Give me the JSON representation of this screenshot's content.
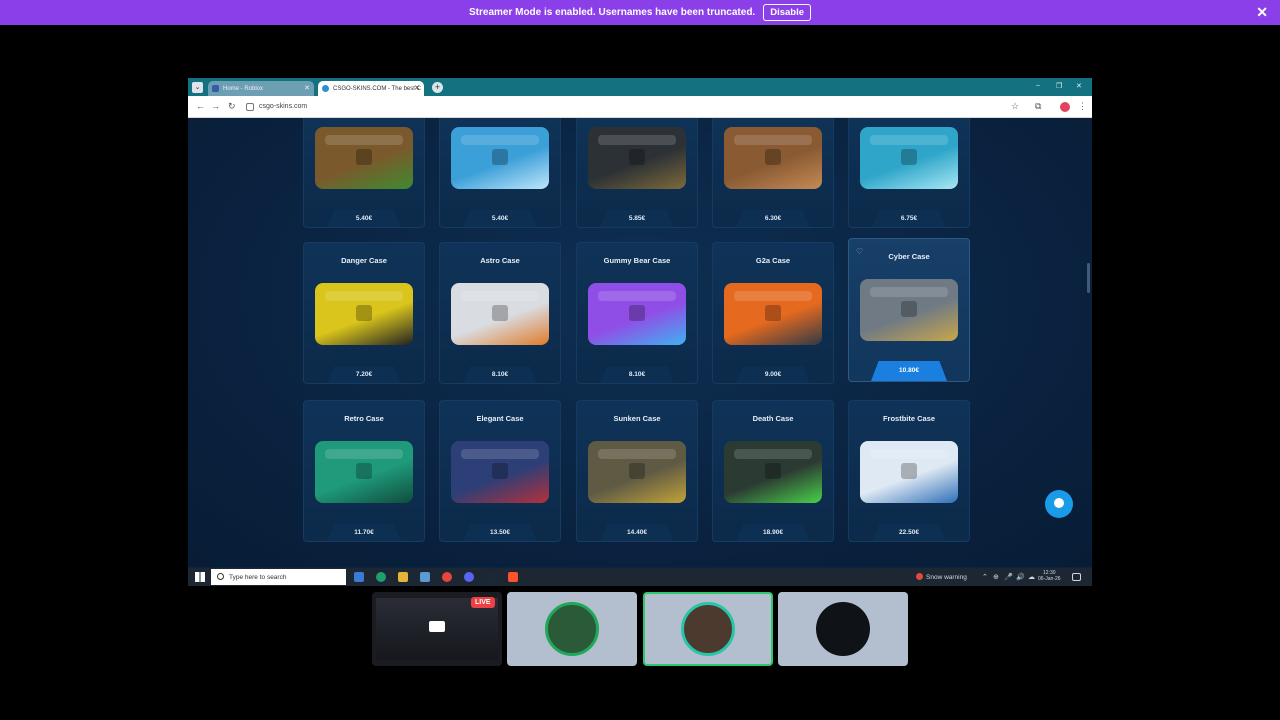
{
  "banner": {
    "message": "Streamer Mode is enabled. Usernames have been truncated.",
    "disable_label": "Disable",
    "close_glyph": "✕"
  },
  "browser": {
    "tabs": [
      {
        "label": "Home - Roblox",
        "close": "✕"
      },
      {
        "label": "CSGO-SKINS.COM - The best C",
        "close": "✕"
      }
    ],
    "newtab": "+",
    "window_controls": [
      "–",
      "❐",
      "✕"
    ],
    "url": "csgo-skins.com",
    "nav": [
      "←",
      "→",
      "↻"
    ],
    "tools": [
      "☆",
      "⧉",
      "⋮"
    ]
  },
  "cases": [
    {
      "name": "",
      "price": "5.40€",
      "color": "#7a5a2c",
      "accent": "#3f8a2f"
    },
    {
      "name": "",
      "price": "5.40€",
      "color": "#3b9fd8",
      "accent": "#bfe6fb"
    },
    {
      "name": "",
      "price": "5.85€",
      "color": "#2c3136",
      "accent": "#7d6a3a"
    },
    {
      "name": "",
      "price": "6.30€",
      "color": "#8a5a33",
      "accent": "#c48a55"
    },
    {
      "name": "",
      "price": "6.75€",
      "color": "#2fa6c9",
      "accent": "#a9e7f5"
    },
    {
      "name": "Danger Case",
      "price": "7.20€",
      "color": "#d9c51c",
      "accent": "#222222"
    },
    {
      "name": "Astro Case",
      "price": "8.10€",
      "color": "#d9dde2",
      "accent": "#e07a2a"
    },
    {
      "name": "Gummy Bear Case",
      "price": "8.10€",
      "color": "#8f4fe6",
      "accent": "#3fb2f0"
    },
    {
      "name": "G2a Case",
      "price": "9.00€",
      "color": "#e5691f",
      "accent": "#2f3a46"
    },
    {
      "name": "Cyber Case",
      "price": "10.80€",
      "color": "#6f7a84",
      "accent": "#c9a64a"
    },
    {
      "name": "Retro Case",
      "price": "11.70€",
      "color": "#1f9a7a",
      "accent": "#0f4d3d"
    },
    {
      "name": "Elegant Case",
      "price": "13.50€",
      "color": "#2c3f77",
      "accent": "#b5303a"
    },
    {
      "name": "Sunken Case",
      "price": "14.40€",
      "color": "#5e5a44",
      "accent": "#c2a23a"
    },
    {
      "name": "Death Case",
      "price": "18.90€",
      "color": "#2b3a33",
      "accent": "#49d14a"
    },
    {
      "name": "Frostbite Case",
      "price": "22.50€",
      "color": "#dfe9f3",
      "accent": "#2d6fb8"
    }
  ],
  "taskbar": {
    "search_placeholder": "Type here to search",
    "weather": "Snow warning",
    "time": "12:30",
    "date": "06-Jan-26",
    "tray": [
      "⌃",
      "⊕",
      "🎤",
      "🔊",
      "☁"
    ]
  },
  "participants": {
    "live_label": "LIVE"
  }
}
